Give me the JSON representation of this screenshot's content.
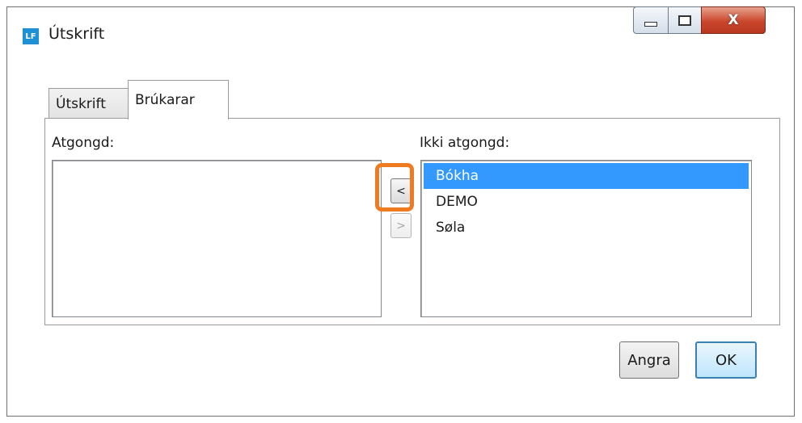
{
  "window": {
    "title": "Útskrift",
    "app_icon_text": "LF",
    "controls": {
      "minimize": "minimize",
      "maximize": "maximize",
      "close": "X"
    }
  },
  "tabs": [
    {
      "label": "Útskrift",
      "selected": false
    },
    {
      "label": "Brúkarar",
      "selected": true
    }
  ],
  "left_list": {
    "label": "Atgongd:",
    "items": []
  },
  "right_list": {
    "label": "Ikki atgongd:",
    "items": [
      {
        "label": "Bókha",
        "selected": true
      },
      {
        "label": "DEMO",
        "selected": false
      },
      {
        "label": "Søla",
        "selected": false
      }
    ]
  },
  "move_buttons": {
    "add": "<",
    "remove": ">"
  },
  "buttons": {
    "cancel": "Angra",
    "ok": "OK"
  },
  "colors": {
    "selection": "#3399ff",
    "highlight": "#f07a1f",
    "app_icon": "#1e90d6"
  }
}
